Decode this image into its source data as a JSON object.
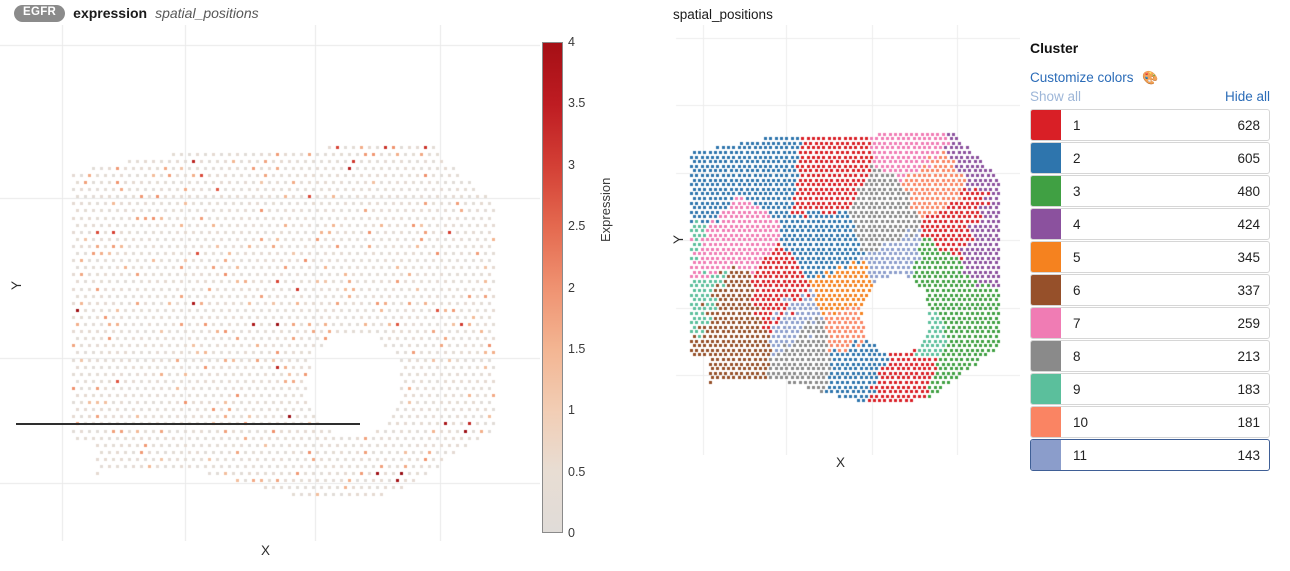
{
  "left_panel": {
    "gene_badge": "EGFR",
    "header_strong": "expression",
    "header_italic": "spatial_positions",
    "x_label": "X",
    "y_label": "Y"
  },
  "colorbar": {
    "label": "Expression",
    "ticks": [
      "4",
      "3.5",
      "3",
      "2.5",
      "2",
      "1.5",
      "1",
      "0.5",
      "0"
    ],
    "min": 0,
    "max": 4,
    "low_color": "#e0dcd8",
    "high_color": "#a50f15"
  },
  "right_panel": {
    "title": "spatial_positions",
    "x_label": "X",
    "y_label": "Y"
  },
  "legend": {
    "title": "Cluster",
    "customize_label": "Customize colors",
    "palette_icon": "palette-icon",
    "show_all_label": "Show all",
    "hide_all_label": "Hide all",
    "selected_index": 10,
    "rows": [
      {
        "id": "1",
        "count": "628",
        "color": "#d91f26"
      },
      {
        "id": "2",
        "count": "605",
        "color": "#2e75ad"
      },
      {
        "id": "3",
        "count": "480",
        "color": "#40a043"
      },
      {
        "id": "4",
        "count": "424",
        "color": "#8b519e"
      },
      {
        "id": "5",
        "count": "345",
        "color": "#f5821f"
      },
      {
        "id": "6",
        "count": "337",
        "color": "#96502a"
      },
      {
        "id": "7",
        "count": "259",
        "color": "#f07cb4"
      },
      {
        "id": "8",
        "count": "213",
        "color": "#8a8a8a"
      },
      {
        "id": "9",
        "count": "183",
        "color": "#5bbf9c"
      },
      {
        "id": "10",
        "count": "181",
        "color": "#fa8463"
      },
      {
        "id": "11",
        "count": "143",
        "color": "#8b9dcb"
      }
    ]
  },
  "chart_data": [
    {
      "type": "scatter",
      "name": "expression-spatial-map",
      "title": "EGFR expression spatial_positions",
      "xlabel": "X",
      "ylabel": "Y",
      "grid": true,
      "colorbar": {
        "label": "Expression",
        "min": 0,
        "max": 4,
        "ticks": [
          0,
          0.5,
          1,
          1.5,
          2,
          2.5,
          3,
          3.5,
          4
        ]
      },
      "marker": "square",
      "point_count": 3798,
      "note": "Hexagonally-tiled spot grid; most spots near 0 expression (light grey), scattered orange/red spots of higher expression. A tissue hole (no spots) sits right-of-centre."
    },
    {
      "type": "scatter",
      "name": "cluster-spatial-map",
      "title": "spatial_positions",
      "xlabel": "X",
      "ylabel": "Y",
      "grid": true,
      "marker": "square",
      "categories": [
        "1",
        "2",
        "3",
        "4",
        "5",
        "6",
        "7",
        "8",
        "9",
        "10",
        "11"
      ],
      "values": [
        628,
        605,
        480,
        424,
        345,
        337,
        259,
        213,
        183,
        181,
        143
      ],
      "colors": [
        "#d91f26",
        "#2e75ad",
        "#40a043",
        "#8b519e",
        "#f5821f",
        "#96502a",
        "#f07cb4",
        "#8a8a8a",
        "#5bbf9c",
        "#fa8463",
        "#8b9dcb"
      ],
      "total_points": 3798,
      "legend_position": "right"
    }
  ]
}
